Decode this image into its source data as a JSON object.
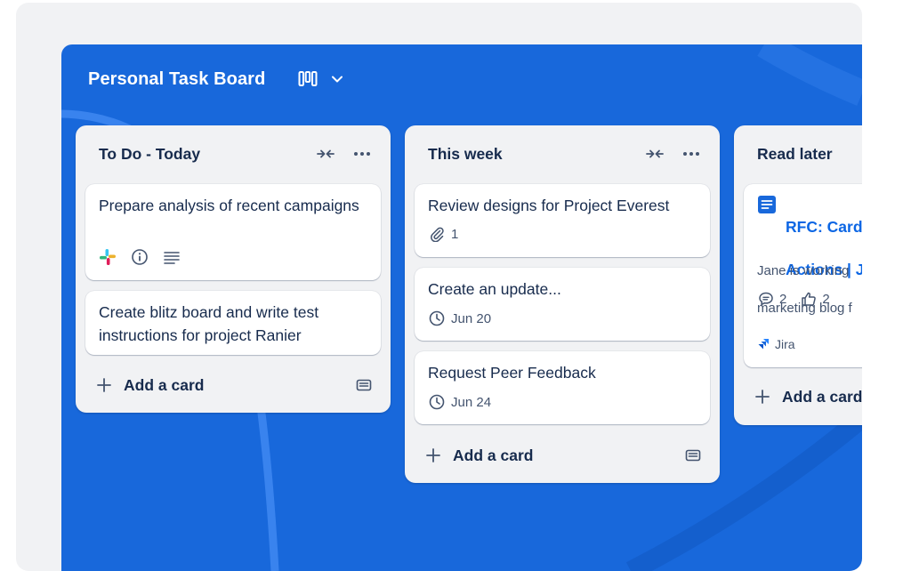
{
  "board": {
    "title": "Personal Task Board",
    "view_icon": "board-view-icon",
    "menu_icon": "chevron-down-icon"
  },
  "lists": [
    {
      "title": "To Do - Today",
      "collapse_icon": "collapse-icon",
      "menu_icon": "more-icon",
      "cards": [
        {
          "title": "Prepare analysis of recent campaigns",
          "badges": [
            "slack-icon",
            "info-icon",
            "description-icon"
          ]
        },
        {
          "title": "Create blitz board and write test instructions for project Ranier"
        }
      ],
      "add_label": "Add a card"
    },
    {
      "title": "This week",
      "collapse_icon": "collapse-icon",
      "menu_icon": "more-icon",
      "cards": [
        {
          "title": "Review designs for Project Everest",
          "attachments": "1"
        },
        {
          "title": "Create an update...",
          "due": "Jun 20"
        },
        {
          "title": "Request Peer Feedback",
          "due": "Jun 24"
        }
      ],
      "add_label": "Add a card"
    },
    {
      "title": "Read later",
      "cards": [
        {
          "title_line1": "RFC: Card",
          "title_line2": "Actions | J",
          "desc_line1": "Jane is working",
          "desc_line2": "marketing blog f",
          "comments": "2",
          "likes": "2",
          "source": "Jira"
        }
      ],
      "add_label": "Add a card"
    }
  ],
  "colors": {
    "board_bg": "#1868db",
    "list_bg": "#f1f2f4",
    "text": "#172b4d",
    "link": "#0c66e4"
  }
}
